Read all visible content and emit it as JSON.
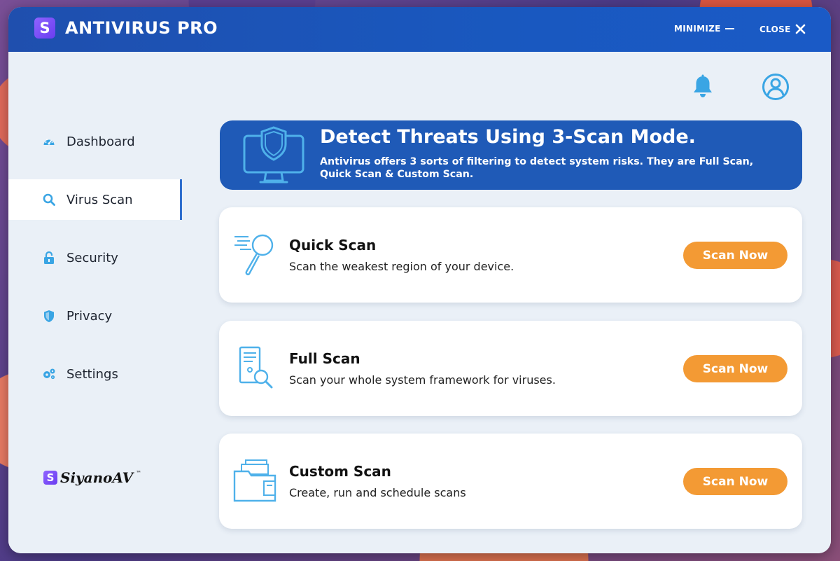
{
  "app": {
    "title": "ANTIVIRUS PRO",
    "logo_letter": "S",
    "minimize_label": "MINIMIZE",
    "close_label": "CLOSE"
  },
  "colors": {
    "accent": "#1f5ab7",
    "button": "#f39a34",
    "icon": "#3aa5e4"
  },
  "sidebar": {
    "items": [
      {
        "label": "Dashboard",
        "icon": "dashboard-icon"
      },
      {
        "label": "Virus Scan",
        "icon": "search-icon",
        "active": true
      },
      {
        "label": "Security",
        "icon": "lock-icon"
      },
      {
        "label": "Privacy",
        "icon": "shield-icon"
      },
      {
        "label": "Settings",
        "icon": "gears-icon"
      }
    ],
    "brand": {
      "letter": "S",
      "name": "SiyanoAV",
      "mark": "™"
    }
  },
  "header": {
    "notification_icon": "bell-icon",
    "profile_icon": "user-icon"
  },
  "banner": {
    "title": "Detect Threats Using 3-Scan Mode.",
    "text": "Antivirus offers 3 sorts of filtering to detect system risks. They are Full Scan, Quick Scan & Custom Scan.",
    "icon": "monitor-shield-icon"
  },
  "scans": [
    {
      "title": "Quick Scan",
      "description": "Scan the weakest region of your device.",
      "button": "Scan Now",
      "icon": "magnifier-icon"
    },
    {
      "title": "Full Scan",
      "description": "Scan your whole system framework for viruses.",
      "button": "Scan Now",
      "icon": "document-search-icon"
    },
    {
      "title": "Custom Scan",
      "description": "Create, run and schedule scans",
      "button": "Scan Now",
      "icon": "folder-icon"
    }
  ]
}
